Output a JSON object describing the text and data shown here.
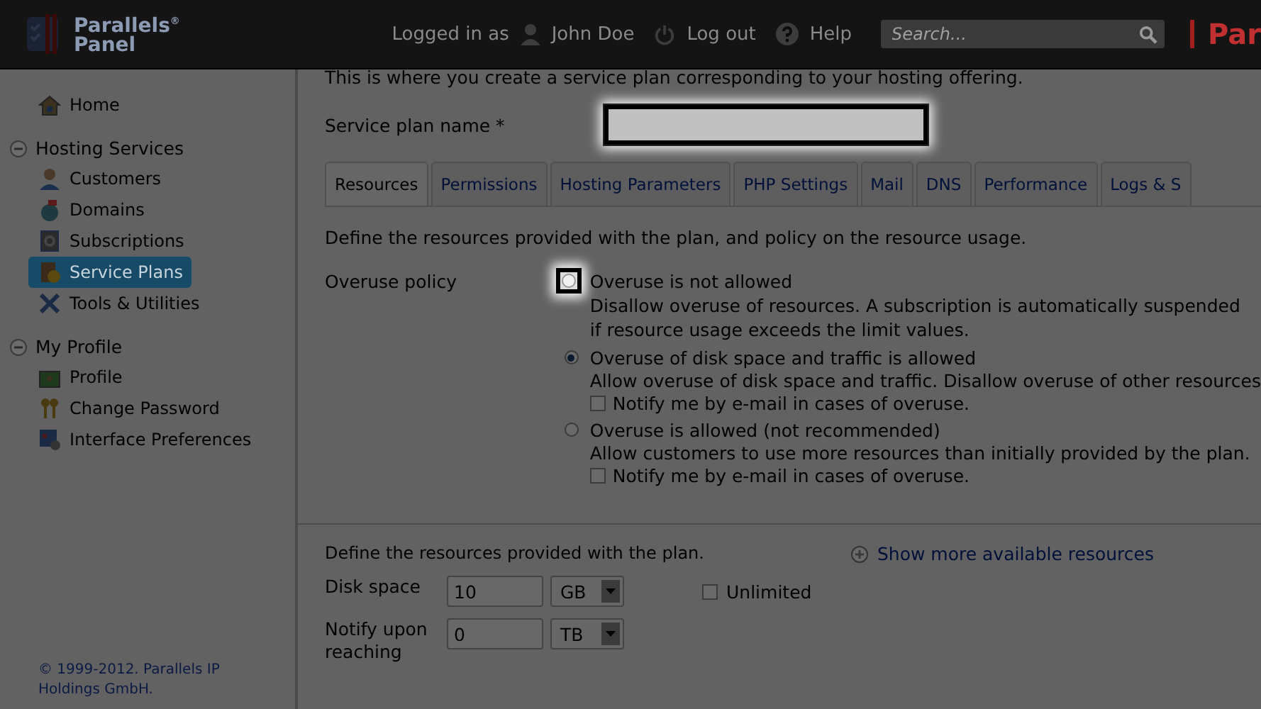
{
  "header": {
    "logo_line1": "Parallels",
    "logo_mark": "®",
    "logo_line2": "Panel",
    "logged_in_label": "Logged in as",
    "user_name": "John Doe",
    "logout": "Log out",
    "help": "Help",
    "search": {
      "placeholder": "Search..."
    },
    "brand_partial": "Par"
  },
  "sidebar": {
    "items": [
      {
        "label": "Home",
        "kind": "link",
        "selected": false
      },
      {
        "label": "Hosting Services",
        "kind": "group",
        "expanded": true,
        "children": [
          {
            "label": "Customers",
            "selected": false
          },
          {
            "label": "Domains",
            "selected": false
          },
          {
            "label": "Subscriptions",
            "selected": false
          },
          {
            "label": "Service Plans",
            "selected": true
          },
          {
            "label": "Tools & Utilities",
            "selected": false
          }
        ]
      },
      {
        "label": "My Profile",
        "kind": "group",
        "expanded": true,
        "children": [
          {
            "label": "Profile",
            "selected": false
          },
          {
            "label": "Change Password",
            "selected": false
          },
          {
            "label": "Interface Preferences",
            "selected": false
          }
        ]
      }
    ],
    "footer": "© 1999-2012. Parallels IP Holdings GmbH."
  },
  "intro": "This is where you create a service plan corresponding to your hosting offering.",
  "service_plan_name": {
    "label": "Service plan name *",
    "highlighted": true
  },
  "tabs": [
    {
      "label": "Resources",
      "selected": true
    },
    {
      "label": "Permissions",
      "selected": false
    },
    {
      "label": "Hosting Parameters",
      "selected": false
    },
    {
      "label": "PHP Settings",
      "selected": false
    },
    {
      "label": "Mail",
      "selected": false
    },
    {
      "label": "DNS",
      "selected": false
    },
    {
      "label": "Performance",
      "selected": false
    },
    {
      "label": "Logs & S",
      "selected": false
    }
  ],
  "policy_intro": "Define the resources provided with the plan, and policy on the resource usage.",
  "overuse_policy": {
    "label": "Overuse policy",
    "options": [
      {
        "title": "Overuse is not allowed",
        "description": "Disallow overuse of resources. A subscription is automatically suspended if resource usage exceeds the limit values.",
        "selected": false,
        "highlighted": true
      },
      {
        "title": "Overuse of disk space and traffic is allowed",
        "description": "Allow overuse of disk space and traffic. Disallow overuse of other resources",
        "selected": true,
        "highlighted": false,
        "notify": {
          "label": "Notify me by e-mail in cases of overuse.",
          "checked": false
        }
      },
      {
        "title": "Overuse is allowed (not recommended)",
        "description": "Allow customers to use more resources than initially provided by the plan.",
        "selected": false,
        "highlighted": false,
        "notify": {
          "label": "Notify me by e-mail in cases of overuse.",
          "checked": false
        }
      }
    ]
  },
  "resources_intro": "Define the resources provided with the plan.",
  "show_more": "Show more available resources",
  "resources": [
    {
      "label": "Disk space",
      "value": "10",
      "unit": "GB",
      "unlimited": {
        "label": "Unlimited",
        "checked": false
      }
    },
    {
      "label": "Notify upon reaching",
      "value": "0",
      "unit": "TB"
    }
  ]
}
